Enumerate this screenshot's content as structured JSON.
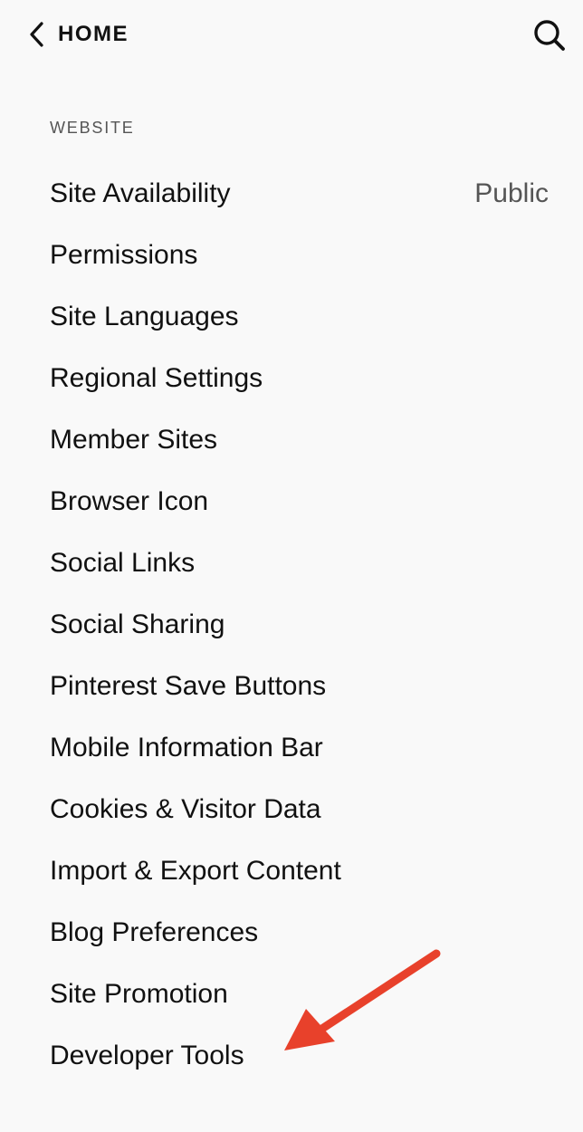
{
  "header": {
    "back_label": "HOME",
    "back_icon": "chevron-left-icon",
    "search_icon": "search-icon"
  },
  "section": {
    "label": "WEBSITE"
  },
  "menu": {
    "items": [
      {
        "label": "Site Availability",
        "value": "Public"
      },
      {
        "label": "Permissions"
      },
      {
        "label": "Site Languages"
      },
      {
        "label": "Regional Settings"
      },
      {
        "label": "Member Sites"
      },
      {
        "label": "Browser Icon"
      },
      {
        "label": "Social Links"
      },
      {
        "label": "Social Sharing"
      },
      {
        "label": "Pinterest Save Buttons"
      },
      {
        "label": "Mobile Information Bar"
      },
      {
        "label": "Cookies & Visitor Data"
      },
      {
        "label": "Import & Export Content"
      },
      {
        "label": "Blog Preferences"
      },
      {
        "label": "Site Promotion"
      },
      {
        "label": "Developer Tools"
      }
    ]
  },
  "colors": {
    "background": "#f9f9f9",
    "text": "#111111",
    "muted": "#555555",
    "annotation_arrow": "#e8412b"
  }
}
